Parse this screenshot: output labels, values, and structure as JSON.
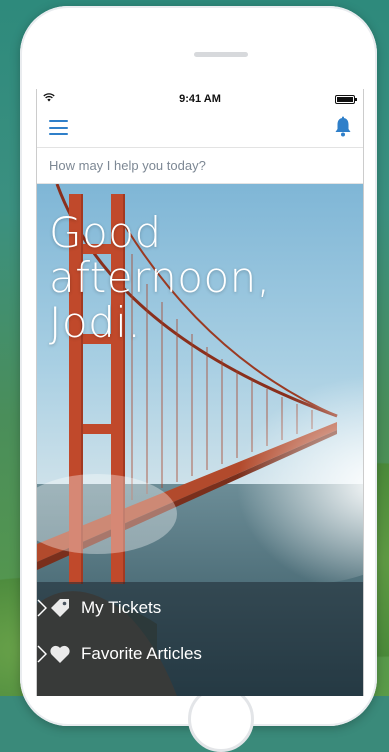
{
  "status_bar": {
    "time": "9:41 AM"
  },
  "search": {
    "placeholder": "How may I help you today?"
  },
  "hero": {
    "greeting": "Good afternoon, Jodi."
  },
  "actions": [
    {
      "label": "My Tickets",
      "icon": "tag-icon"
    },
    {
      "label": "Favorite Articles",
      "icon": "heart-icon"
    }
  ],
  "colors": {
    "accent": "#2f7fc9",
    "text_light": "#ffffff"
  }
}
